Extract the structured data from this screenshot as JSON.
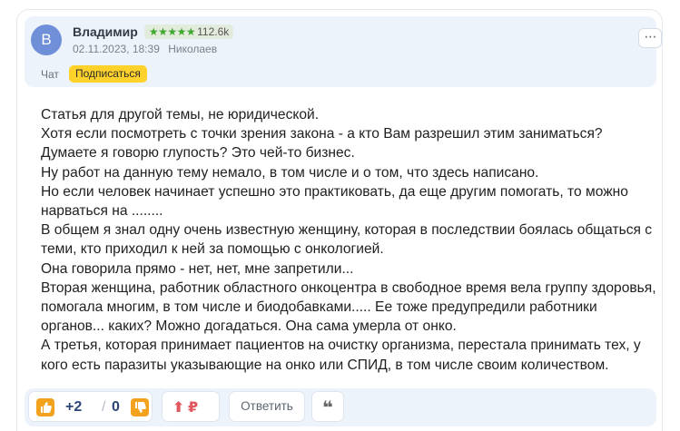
{
  "author": {
    "avatar_letter": "В",
    "name": "Владимир",
    "stars": "★★★★★",
    "rating": "112.6k",
    "date": "02.11.2023, 18:39",
    "location": "Николаев"
  },
  "actions": {
    "chat_label": "Чат",
    "subscribe_label": "Подписаться",
    "more_icon": "⋯"
  },
  "paragraphs": [
    "Статья для другой темы, не юридической.",
    "Хотя если посмотреть с точки зрения закона - а кто Вам разрешил этим заниматься?",
    "Думаете я говорю глупость? Это чей-то бизнес.",
    "Ну работ на данную тему немало, в том числе и о том, что здесь написано.",
    "Но если человек начинает успешно это практиковать, да еще другим помогать, то можно нарваться на ........",
    "В общем я знал одну очень известную женщину, которая в последствии боялась общаться с теми, кто приходил к ней за помощью с онкологией.",
    "Она говорила прямо - нет, нет, мне запретили...",
    "Вторая женщина, работник областного онкоцентра в свободное время вела группу здоровья, помогала многим, в том числе и биодобавками..... Ее тоже предупредили работники органов... каких? Можно догадаться. Она сама умерла от онко.",
    "А третья, которая принимает пациентов на очистку организма, перестала принимать тех, у кого есть паразиты указывающие на онко или СПИД, в том числе своим количеством."
  ],
  "footer": {
    "votes_up": "+2",
    "separator": "/",
    "votes_down": "0",
    "tip_arrow": "⬆",
    "tip_currency": "₽",
    "reply_label": "Ответить",
    "quote_icon": "❝"
  },
  "colors": {
    "accent_yellow": "#ffd22b",
    "thumb_orange": "#f2a21c",
    "header_bg": "#edf3fb",
    "avatar": "#6f8fd8",
    "star_green": "#3ea82f",
    "tip_red": "#e0575e"
  }
}
